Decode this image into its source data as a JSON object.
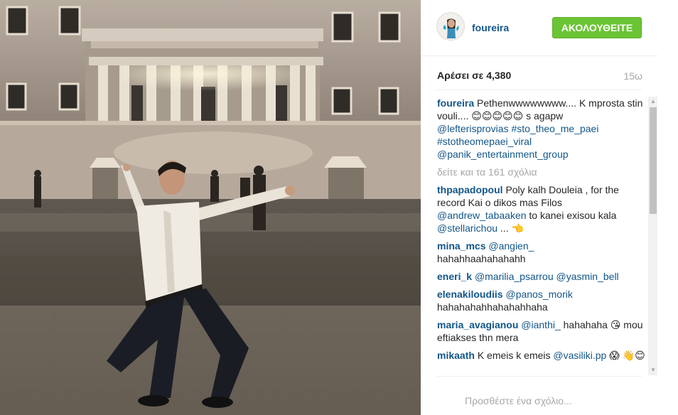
{
  "post": {
    "username": "foureira",
    "follow_label": "ΑΚΟΛΟΥΘΕΙΤΕ",
    "likes_text": "Αρέσει σε 4,380",
    "time_ago": "15ω",
    "view_all_comments": "δείτε και τα 161 σχόλια",
    "add_comment_placeholder": "Προσθέστε ένα σχόλιο..."
  },
  "caption": {
    "user": "foureira",
    "text": "Pethenwwwwwwww.... K mprosta stin vouli.... 😊😊😊😊😊 s agapw",
    "mention1": "@lefterisprovias",
    "tag1": "#sto_theo_me_paei",
    "tag2": "#stotheomepaei_viral",
    "mention2": "@panik_entertainment_group"
  },
  "comments": [
    {
      "user": "thpapadopoul",
      "pre": "Poly kalh Douleia , for the record Kai o dikos mas Filos",
      "mention1": "@andrew_tabaaken",
      "mid": "to kanei exisou kala",
      "mention2": "@stellarichou",
      "post": "... 👈"
    },
    {
      "user": "mina_mcs",
      "mention1": "@angien_",
      "text": "hahahhaahahahahh"
    },
    {
      "user": "eneri_k",
      "mention1": "@marilia_psarrou",
      "mention2": "@yasmin_bell"
    },
    {
      "user": "elenakiloudiis",
      "mention1": "@panos_morik",
      "text": "hahahahahhahahahhaha"
    },
    {
      "user": "maria_avagianou",
      "mention1": "@ianthi_",
      "text": "hahahaha 😘 mou eftiakses thn mera"
    },
    {
      "user": "mikaath",
      "pre": "K emeis k emeis",
      "mention1": "@vasiliki.pp",
      "post": "😱 👋😊"
    }
  ],
  "colors": {
    "accent_link": "#125688",
    "follow_green": "#6bc435",
    "muted": "#a5a7aa"
  }
}
